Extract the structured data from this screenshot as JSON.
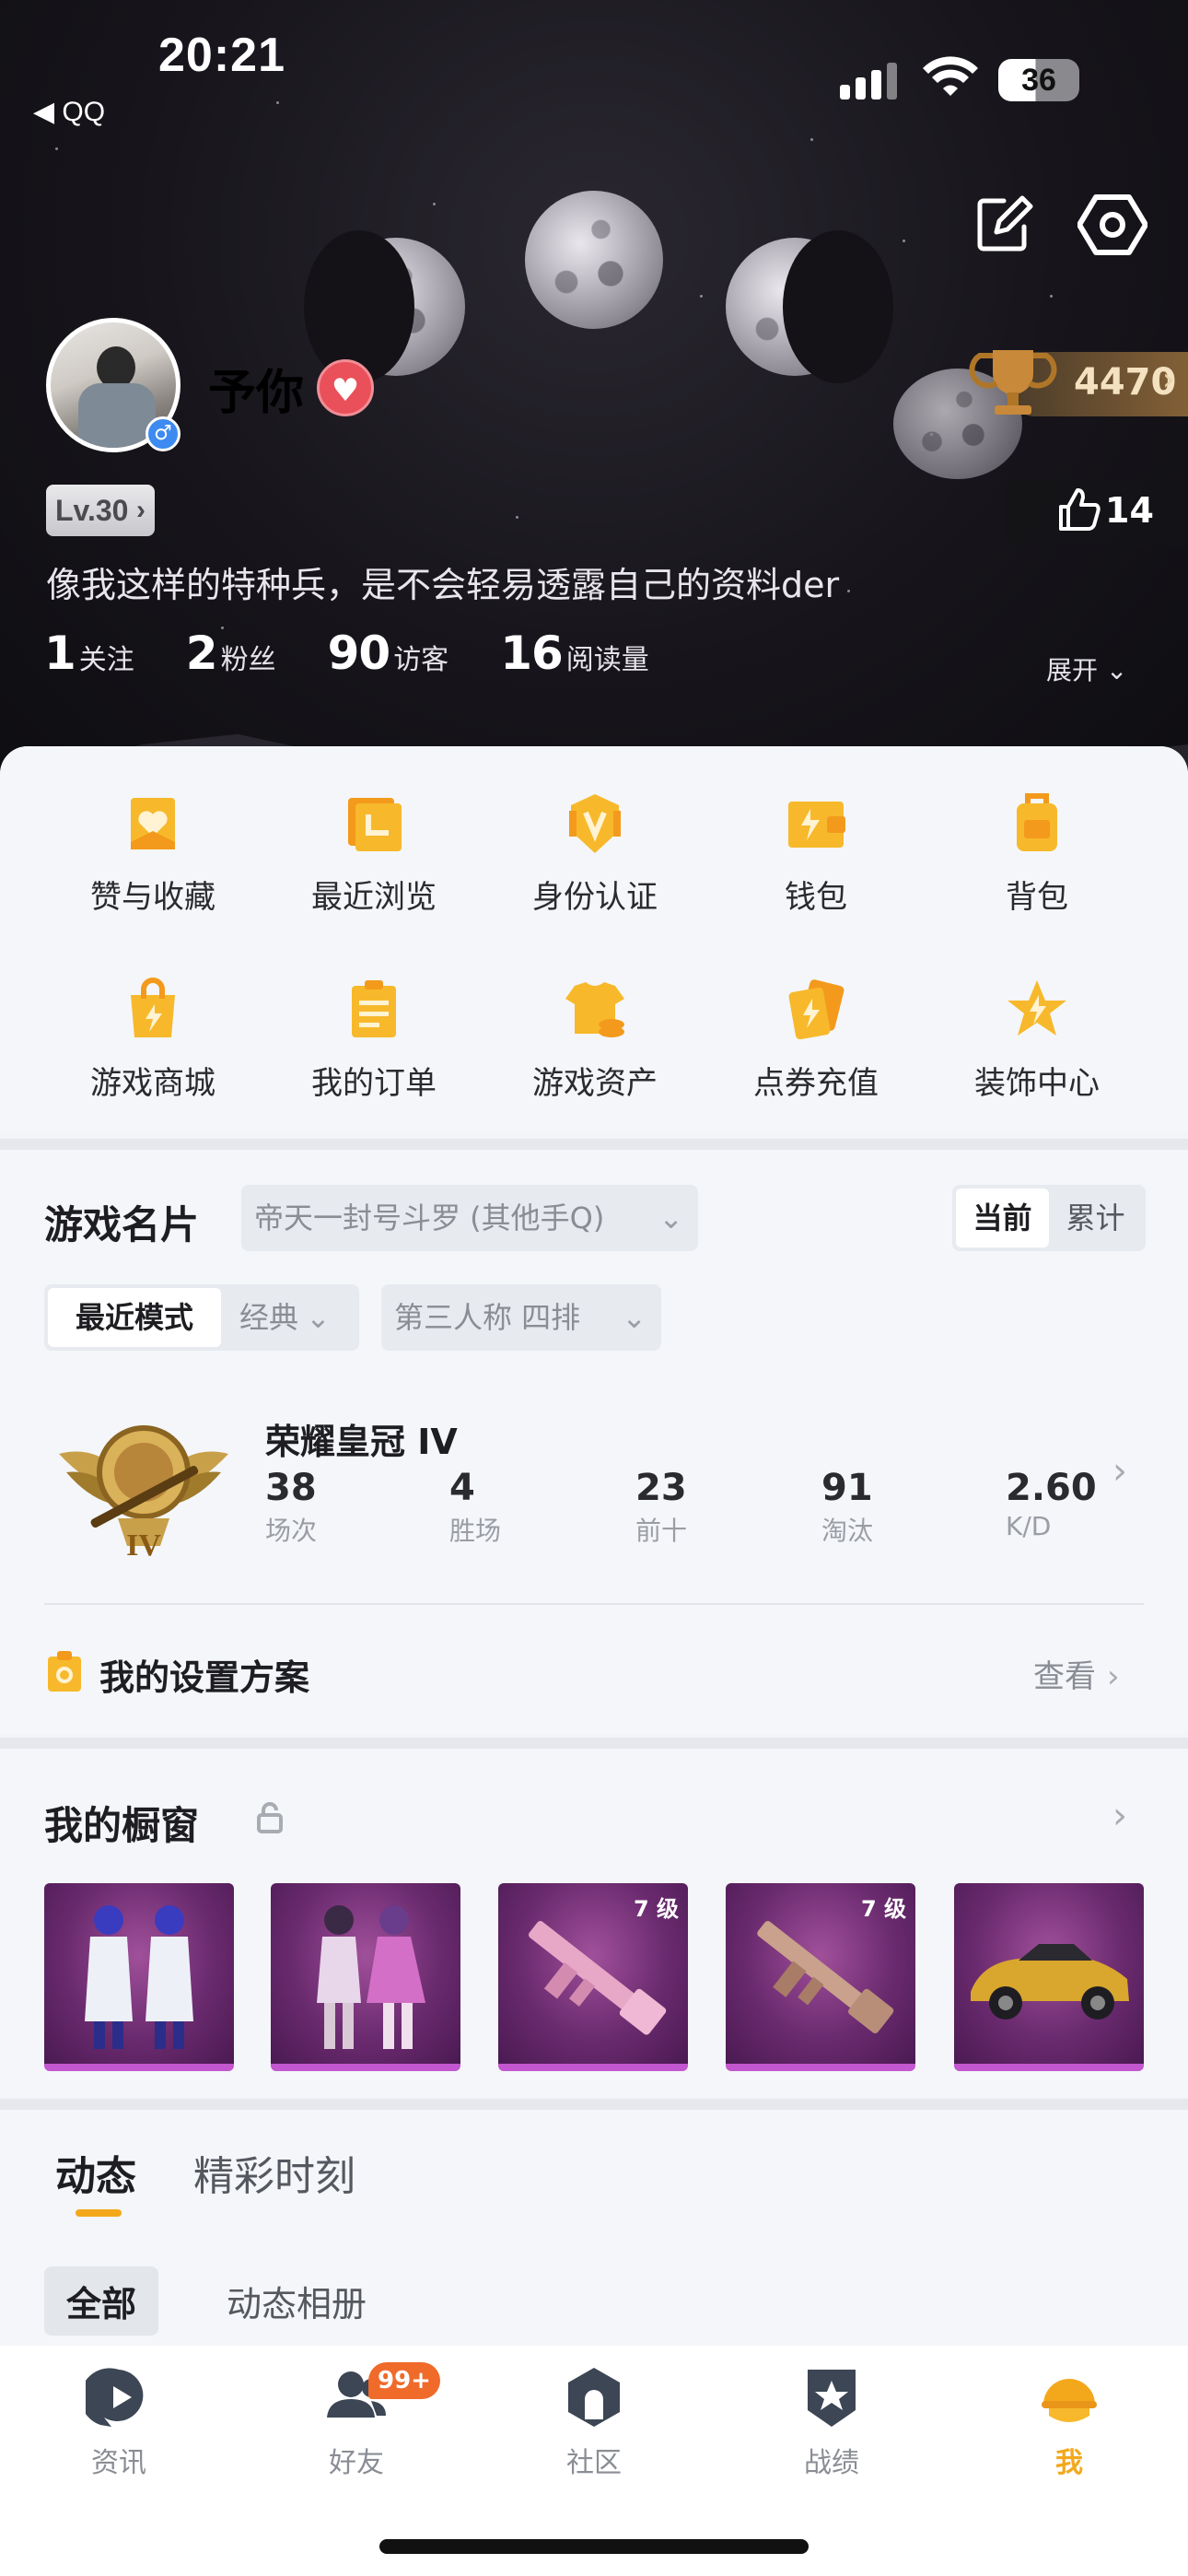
{
  "status_bar": {
    "time": "20:21",
    "back_app": "◀ QQ",
    "battery": "36"
  },
  "profile": {
    "username": "予你",
    "trophy_score": "4470",
    "level": "Lv.30",
    "likes": "14",
    "bio": "像我这样的特种兵，是不会轻易透露自己的资料der",
    "stats": [
      {
        "num": "1",
        "label": "关注"
      },
      {
        "num": "2",
        "label": "粉丝"
      },
      {
        "num": "90",
        "label": "访客"
      },
      {
        "num": "16",
        "label": "阅读量"
      }
    ],
    "expand": "展开"
  },
  "menu": [
    {
      "label": "赞与收藏",
      "icon": "like-collect-icon"
    },
    {
      "label": "最近浏览",
      "icon": "recent-icon"
    },
    {
      "label": "身份认证",
      "icon": "verify-icon"
    },
    {
      "label": "钱包",
      "icon": "wallet-icon"
    },
    {
      "label": "背包",
      "icon": "backpack-icon"
    },
    {
      "label": "游戏商城",
      "icon": "shop-icon"
    },
    {
      "label": "我的订单",
      "icon": "orders-icon"
    },
    {
      "label": "游戏资产",
      "icon": "assets-icon"
    },
    {
      "label": "点券充值",
      "icon": "recharge-icon"
    },
    {
      "label": "装饰中心",
      "icon": "decor-icon"
    }
  ],
  "game_card": {
    "title": "游戏名片",
    "server": "帝天一封号斗罗 (其他手Q)",
    "toggle": [
      "当前",
      "累计"
    ],
    "mode_recent": "最近模式",
    "mode_classic": "经典",
    "perspective": "第三人称  四排",
    "rank_name": "荣耀皇冠 IV",
    "rank_tier": "IV",
    "stats": [
      {
        "num": "38",
        "label": "场次"
      },
      {
        "num": "4",
        "label": "胜场"
      },
      {
        "num": "23",
        "label": "前十"
      },
      {
        "num": "91",
        "label": "淘汰"
      },
      {
        "num": "2.60",
        "label": "K/D"
      }
    ],
    "settings_title": "我的设置方案",
    "settings_view": "查看"
  },
  "showcase": {
    "title": "我的橱窗",
    "items": [
      {
        "name": "outfit-white-blue",
        "level": ""
      },
      {
        "name": "outfit-pink-duo",
        "level": ""
      },
      {
        "name": "rifle-pink",
        "level": "7 级"
      },
      {
        "name": "rifle-tan",
        "level": "7 级"
      },
      {
        "name": "car-gold",
        "level": ""
      }
    ]
  },
  "feed": {
    "tabs": [
      "动态",
      "精彩时刻"
    ],
    "sub_tabs": [
      "全部",
      "动态相册"
    ]
  },
  "tabbar": {
    "items": [
      "资讯",
      "好友",
      "社区",
      "战绩",
      "我"
    ],
    "friends_badge": "99+",
    "active_color": "#f3a81c"
  }
}
